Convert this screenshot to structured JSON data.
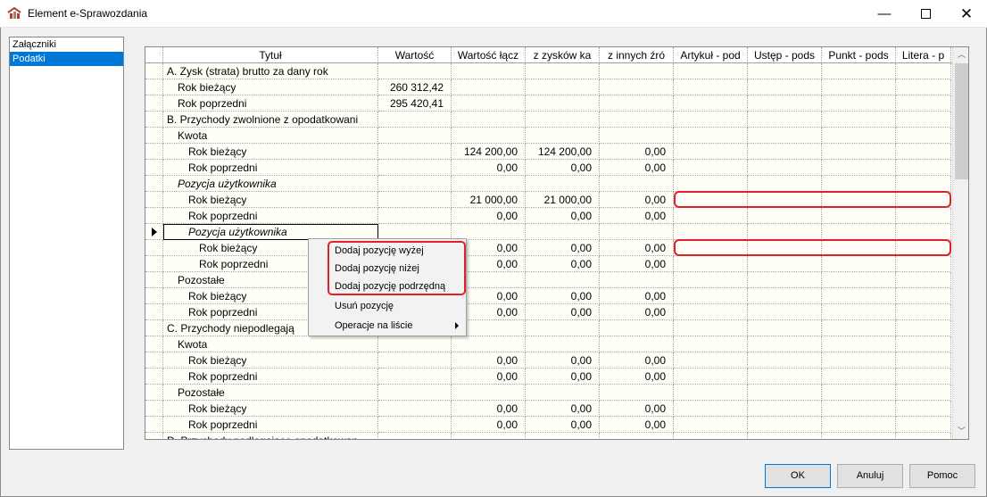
{
  "window": {
    "title": "Element e-Sprawozdania",
    "minimize": "—",
    "close": "✕"
  },
  "left_list": {
    "items": [
      {
        "label": "Załączniki",
        "selected": false
      },
      {
        "label": "Podatki",
        "selected": true
      }
    ]
  },
  "grid": {
    "headers": [
      "Tytuł",
      "Wartość",
      "Wartość łącz",
      "z zysków ka",
      "z innych źró",
      "Artykuł - pod",
      "Ustęp - pods",
      "Punkt - pods",
      "Litera - p"
    ],
    "rows": [
      {
        "title": "A. Zysk (strata) brutto za dany rok",
        "level": 0,
        "italic": false,
        "values": [
          "",
          "",
          "",
          ""
        ]
      },
      {
        "title": "Rok bieżący",
        "level": 1,
        "italic": false,
        "values": [
          "260 312,42",
          "",
          "",
          ""
        ]
      },
      {
        "title": "Rok poprzedni",
        "level": 1,
        "italic": false,
        "values": [
          "295 420,41",
          "",
          "",
          ""
        ]
      },
      {
        "title": "B. Przychody zwolnione z opodatkowani",
        "level": 0,
        "italic": false,
        "values": [
          "",
          "",
          "",
          ""
        ]
      },
      {
        "title": "Kwota",
        "level": 1,
        "italic": false,
        "values": [
          "",
          "",
          "",
          ""
        ]
      },
      {
        "title": "Rok bieżący",
        "level": 2,
        "italic": false,
        "values": [
          "",
          "124 200,00",
          "124 200,00",
          "0,00"
        ]
      },
      {
        "title": "Rok poprzedni",
        "level": 2,
        "italic": false,
        "values": [
          "",
          "0,00",
          "0,00",
          "0,00"
        ]
      },
      {
        "title": "Pozycja użytkownika",
        "level": 1,
        "italic": true,
        "values": [
          "",
          "",
          "",
          ""
        ]
      },
      {
        "title": "Rok bieżący",
        "level": 2,
        "italic": false,
        "values": [
          "",
          "21 000,00",
          "21 000,00",
          "0,00"
        ]
      },
      {
        "title": "Rok poprzedni",
        "level": 2,
        "italic": false,
        "values": [
          "",
          "0,00",
          "0,00",
          "0,00"
        ]
      },
      {
        "title": "Pozycja użytkownika",
        "level": 2,
        "italic": true,
        "current": true,
        "values": [
          "",
          "",
          "",
          ""
        ]
      },
      {
        "title": "Rok bieżący",
        "level": 3,
        "italic": false,
        "values": [
          "",
          "0,00",
          "0,00",
          "0,00"
        ]
      },
      {
        "title": "Rok poprzedni",
        "level": 3,
        "italic": false,
        "values": [
          "",
          "0,00",
          "0,00",
          "0,00"
        ]
      },
      {
        "title": "Pozostałe",
        "level": 1,
        "italic": false,
        "values": [
          "",
          "",
          "",
          ""
        ]
      },
      {
        "title": "Rok bieżący",
        "level": 2,
        "italic": false,
        "values": [
          "",
          "0,00",
          "0,00",
          "0,00"
        ]
      },
      {
        "title": "Rok poprzedni",
        "level": 2,
        "italic": false,
        "values": [
          "",
          "0,00",
          "0,00",
          "0,00"
        ]
      },
      {
        "title": "C. Przychody niepodlegają",
        "level": 0,
        "italic": false,
        "values": [
          "",
          "",
          "",
          ""
        ]
      },
      {
        "title": "Kwota",
        "level": 1,
        "italic": false,
        "values": [
          "",
          "",
          "",
          ""
        ]
      },
      {
        "title": "Rok bieżący",
        "level": 2,
        "italic": false,
        "values": [
          "",
          "0,00",
          "0,00",
          "0,00"
        ]
      },
      {
        "title": "Rok poprzedni",
        "level": 2,
        "italic": false,
        "values": [
          "",
          "0,00",
          "0,00",
          "0,00"
        ]
      },
      {
        "title": "Pozostałe",
        "level": 1,
        "italic": false,
        "values": [
          "",
          "",
          "",
          ""
        ]
      },
      {
        "title": "Rok bieżący",
        "level": 2,
        "italic": false,
        "values": [
          "",
          "0,00",
          "0,00",
          "0,00"
        ]
      },
      {
        "title": "Rok poprzedni",
        "level": 2,
        "italic": false,
        "values": [
          "",
          "0,00",
          "0,00",
          "0,00"
        ]
      },
      {
        "title": "D. Przychody podlegające opodatkowan",
        "level": 0,
        "italic": false,
        "values": [
          "",
          "",
          "",
          ""
        ]
      }
    ]
  },
  "context_menu": {
    "items": [
      {
        "label": "Dodaj pozycję wyżej",
        "submenu": false
      },
      {
        "label": "Dodaj pozycję niżej",
        "submenu": false
      },
      {
        "label": "Dodaj pozycję podrzędną",
        "submenu": false
      },
      {
        "label": "Usuń pozycję",
        "submenu": false
      },
      {
        "label": "Operacje na liście",
        "submenu": true
      }
    ]
  },
  "buttons": {
    "ok": "OK",
    "cancel": "Anuluj",
    "help": "Pomoc"
  },
  "colors": {
    "selection": "#0078d7",
    "highlight": "#e0202a",
    "grid_background": "#fffff8"
  }
}
